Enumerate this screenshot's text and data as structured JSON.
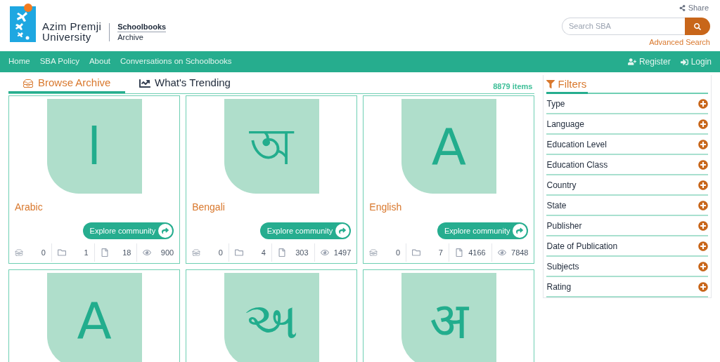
{
  "header": {
    "logo_line1": "Azim Premji",
    "logo_line2": "University",
    "archive_line1": "Schoolbooks",
    "archive_line2": "Archive",
    "share": "Share",
    "search": {
      "placeholder": "Search SBA"
    },
    "advanced_search": "Advanced Search"
  },
  "nav": {
    "items": [
      "Home",
      "SBA Policy",
      "About",
      "Conversations on Schoolbooks"
    ],
    "register": "Register",
    "login": "Login"
  },
  "tabs": [
    {
      "label": "Browse Archive",
      "selected": true,
      "kind": "archive"
    },
    {
      "label": "What's Trending",
      "selected": false,
      "kind": "trending"
    }
  ],
  "item_count": "8879 items",
  "cards": [
    {
      "glyph": "ا",
      "name": "Arabic",
      "button": "Explore community",
      "stats": [
        "0",
        "1",
        "18",
        "900"
      ]
    },
    {
      "glyph": "অ",
      "name": "Bengali",
      "button": "Explore community",
      "stats": [
        "0",
        "4",
        "303",
        "1497"
      ]
    },
    {
      "glyph": "A",
      "name": "English",
      "button": "Explore community",
      "stats": [
        "0",
        "7",
        "4166",
        "7848"
      ]
    },
    {
      "glyph": "A"
    },
    {
      "glyph": "અ"
    },
    {
      "glyph": "अ"
    }
  ],
  "filters": {
    "title": "Filters",
    "items": [
      "Type",
      "Language",
      "Education Level",
      "Education Class",
      "Country",
      "State",
      "Publisher",
      "Date of Publication",
      "Subjects",
      "Rating"
    ]
  }
}
